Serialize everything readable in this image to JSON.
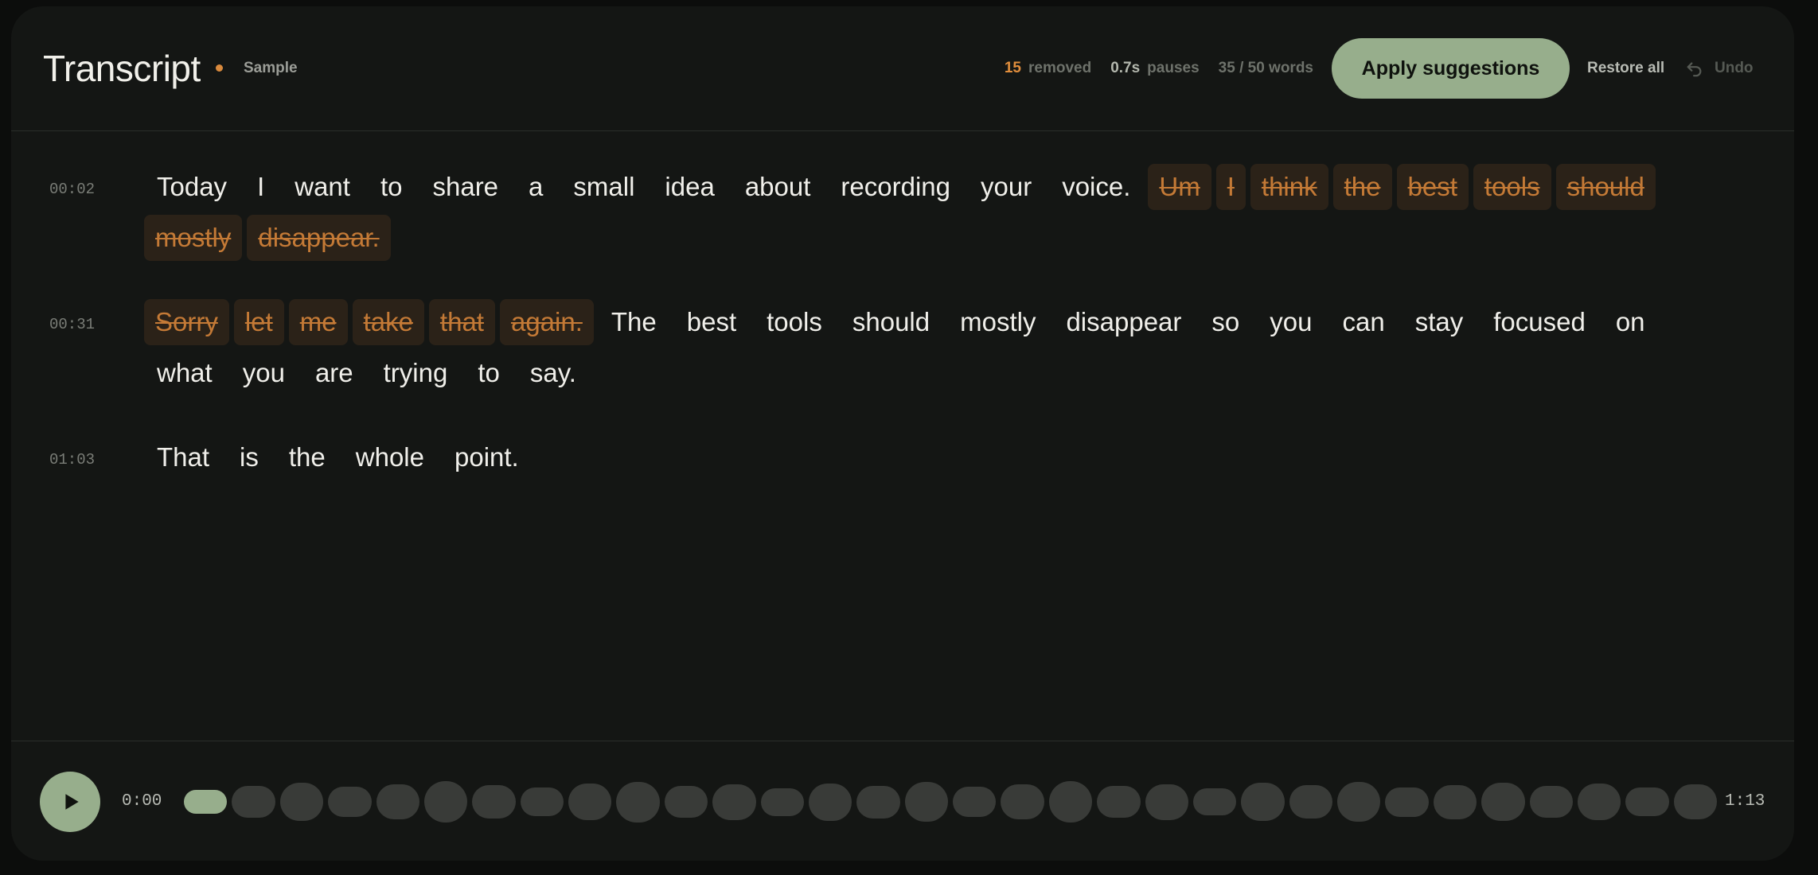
{
  "header": {
    "title": "Transcript",
    "sample_label": "Sample",
    "stats": {
      "removed_count": "15",
      "removed_label": "removed",
      "pauses_value": "0.7s",
      "pauses_label": "pauses",
      "words": "35 / 50 words"
    },
    "apply_label": "Apply suggestions",
    "restore_label": "Restore all",
    "undo_label": "Undo",
    "undo_icon": "undo-icon",
    "status_dot_color": "#d98a3d"
  },
  "transcript": {
    "paragraphs": [
      {
        "timestamp": "00:02",
        "words": [
          {
            "text": "Today",
            "removed": false
          },
          {
            "text": "I",
            "removed": false
          },
          {
            "text": "want",
            "removed": false
          },
          {
            "text": "to",
            "removed": false
          },
          {
            "text": "share",
            "removed": false
          },
          {
            "text": "a",
            "removed": false
          },
          {
            "text": "small",
            "removed": false
          },
          {
            "text": "idea",
            "removed": false
          },
          {
            "text": "about",
            "removed": false
          },
          {
            "text": "recording",
            "removed": false
          },
          {
            "text": "your",
            "removed": false
          },
          {
            "text": "voice.",
            "removed": false
          },
          {
            "text": "Um",
            "removed": true
          },
          {
            "text": "I",
            "removed": true
          },
          {
            "text": "think",
            "removed": true
          },
          {
            "text": "the",
            "removed": true
          },
          {
            "text": "best",
            "removed": true
          },
          {
            "text": "tools",
            "removed": true
          },
          {
            "text": "should",
            "removed": true
          },
          {
            "text": "mostly",
            "removed": true
          },
          {
            "text": "disappear.",
            "removed": true
          }
        ]
      },
      {
        "timestamp": "00:31",
        "words": [
          {
            "text": "Sorry",
            "removed": true
          },
          {
            "text": "let",
            "removed": true
          },
          {
            "text": "me",
            "removed": true
          },
          {
            "text": "take",
            "removed": true
          },
          {
            "text": "that",
            "removed": true
          },
          {
            "text": "again.",
            "removed": true
          },
          {
            "text": "The",
            "removed": false
          },
          {
            "text": "best",
            "removed": false
          },
          {
            "text": "tools",
            "removed": false
          },
          {
            "text": "should",
            "removed": false
          },
          {
            "text": "mostly",
            "removed": false
          },
          {
            "text": "disappear",
            "removed": false
          },
          {
            "text": "so",
            "removed": false
          },
          {
            "text": "you",
            "removed": false
          },
          {
            "text": "can",
            "removed": false
          },
          {
            "text": "stay",
            "removed": false
          },
          {
            "text": "focused",
            "removed": false
          },
          {
            "text": "on",
            "removed": false
          },
          {
            "text": "what",
            "removed": false
          },
          {
            "text": "you",
            "removed": false
          },
          {
            "text": "are",
            "removed": false
          },
          {
            "text": "trying",
            "removed": false
          },
          {
            "text": "to",
            "removed": false
          },
          {
            "text": "say.",
            "removed": false
          }
        ]
      },
      {
        "timestamp": "01:03",
        "words": [
          {
            "text": "That",
            "removed": false
          },
          {
            "text": "is",
            "removed": false
          },
          {
            "text": "the",
            "removed": false
          },
          {
            "text": "whole",
            "removed": false
          },
          {
            "text": "point.",
            "removed": false
          }
        ]
      }
    ]
  },
  "player": {
    "current_time": "0:00",
    "total_time": "1:13",
    "play_icon": "play-icon",
    "accent_color": "#97ae8c",
    "removed_color": "#c47a36",
    "waveform_levels": [
      0.2,
      0.45,
      0.65,
      0.4,
      0.55,
      0.75,
      0.5,
      0.35,
      0.6,
      0.72,
      0.45,
      0.58,
      0.32,
      0.62,
      0.48,
      0.7,
      0.4,
      0.54,
      0.74,
      0.46,
      0.58,
      0.3,
      0.64,
      0.5,
      0.7,
      0.38,
      0.52,
      0.66,
      0.44,
      0.6,
      0.36,
      0.56
    ],
    "played_bars": 1
  }
}
